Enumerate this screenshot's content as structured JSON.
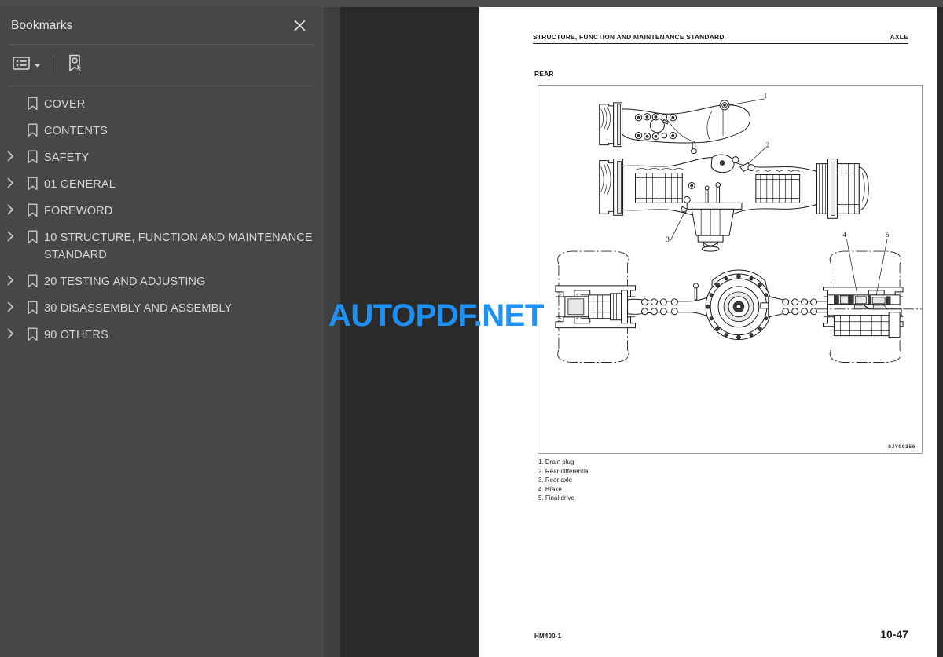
{
  "sidebar": {
    "title": "Bookmarks",
    "close_icon": "close-icon",
    "toolbar": {
      "options_icon": "list-options-icon",
      "options_chevron_icon": "chevron-down-icon",
      "new_bookmark_icon": "new-bookmark-icon"
    },
    "items": [
      {
        "label": "COVER",
        "expandable": false
      },
      {
        "label": "CONTENTS",
        "expandable": false
      },
      {
        "label": "SAFETY",
        "expandable": true
      },
      {
        "label": "01 GENERAL",
        "expandable": true
      },
      {
        "label": "FOREWORD",
        "expandable": true
      },
      {
        "label": "10 STRUCTURE, FUNCTION AND MAINTENANCE STANDARD",
        "expandable": true
      },
      {
        "label": "20 TESTING AND ADJUSTING",
        "expandable": true
      },
      {
        "label": "30 DISASSEMBLY AND ASSEMBLY",
        "expandable": true
      },
      {
        "label": "90 OTHERS",
        "expandable": true
      }
    ]
  },
  "document": {
    "header_left": "STRUCTURE, FUNCTION AND MAINTENANCE STANDARD",
    "header_right": "AXLE",
    "section_title": "REAR",
    "figure_code": "9JY00356",
    "callouts": [
      "1",
      "2",
      "3",
      "4",
      "5"
    ],
    "legend": [
      "1. Drain plug",
      "2. Rear differential",
      "3. Rear axle",
      "4. Brake",
      "5. Final drive"
    ],
    "footer_left": "HM400-1",
    "footer_right": "10-47"
  },
  "watermark": {
    "text_primary": "AUTOPDF",
    "text_secondary": ".NET",
    "color": "#1e90f6"
  },
  "theme": {
    "sidebar_bg": "#474747",
    "viewer_bg": "#2a2a2a",
    "text": "#d6d6d6",
    "page_bg": "#ffffff"
  }
}
